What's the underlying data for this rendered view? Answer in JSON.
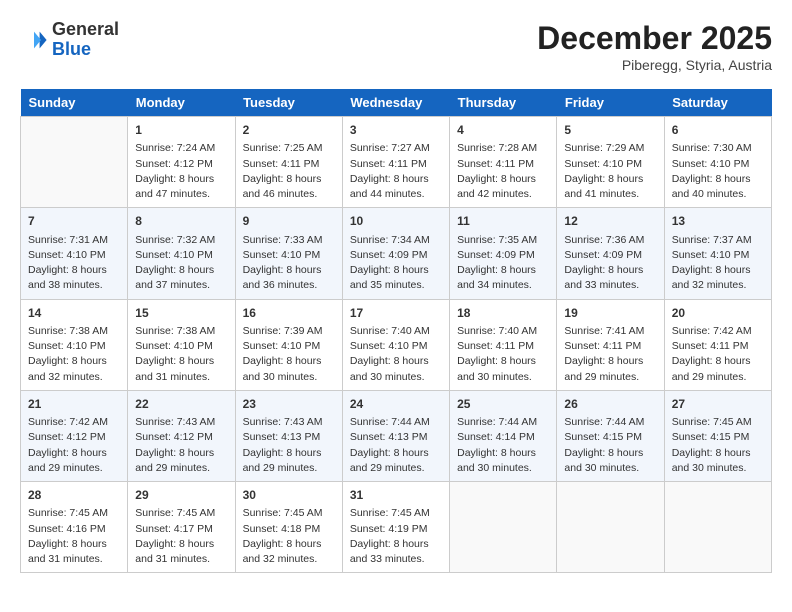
{
  "logo": {
    "general": "General",
    "blue": "Blue"
  },
  "header": {
    "month": "December 2025",
    "location": "Piberegg, Styria, Austria"
  },
  "weekdays": [
    "Sunday",
    "Monday",
    "Tuesday",
    "Wednesday",
    "Thursday",
    "Friday",
    "Saturday"
  ],
  "weeks": [
    [
      {
        "day": "",
        "sunrise": "",
        "sunset": "",
        "daylight": ""
      },
      {
        "day": "1",
        "sunrise": "Sunrise: 7:24 AM",
        "sunset": "Sunset: 4:12 PM",
        "daylight": "Daylight: 8 hours and 47 minutes."
      },
      {
        "day": "2",
        "sunrise": "Sunrise: 7:25 AM",
        "sunset": "Sunset: 4:11 PM",
        "daylight": "Daylight: 8 hours and 46 minutes."
      },
      {
        "day": "3",
        "sunrise": "Sunrise: 7:27 AM",
        "sunset": "Sunset: 4:11 PM",
        "daylight": "Daylight: 8 hours and 44 minutes."
      },
      {
        "day": "4",
        "sunrise": "Sunrise: 7:28 AM",
        "sunset": "Sunset: 4:11 PM",
        "daylight": "Daylight: 8 hours and 42 minutes."
      },
      {
        "day": "5",
        "sunrise": "Sunrise: 7:29 AM",
        "sunset": "Sunset: 4:10 PM",
        "daylight": "Daylight: 8 hours and 41 minutes."
      },
      {
        "day": "6",
        "sunrise": "Sunrise: 7:30 AM",
        "sunset": "Sunset: 4:10 PM",
        "daylight": "Daylight: 8 hours and 40 minutes."
      }
    ],
    [
      {
        "day": "7",
        "sunrise": "Sunrise: 7:31 AM",
        "sunset": "Sunset: 4:10 PM",
        "daylight": "Daylight: 8 hours and 38 minutes."
      },
      {
        "day": "8",
        "sunrise": "Sunrise: 7:32 AM",
        "sunset": "Sunset: 4:10 PM",
        "daylight": "Daylight: 8 hours and 37 minutes."
      },
      {
        "day": "9",
        "sunrise": "Sunrise: 7:33 AM",
        "sunset": "Sunset: 4:10 PM",
        "daylight": "Daylight: 8 hours and 36 minutes."
      },
      {
        "day": "10",
        "sunrise": "Sunrise: 7:34 AM",
        "sunset": "Sunset: 4:09 PM",
        "daylight": "Daylight: 8 hours and 35 minutes."
      },
      {
        "day": "11",
        "sunrise": "Sunrise: 7:35 AM",
        "sunset": "Sunset: 4:09 PM",
        "daylight": "Daylight: 8 hours and 34 minutes."
      },
      {
        "day": "12",
        "sunrise": "Sunrise: 7:36 AM",
        "sunset": "Sunset: 4:09 PM",
        "daylight": "Daylight: 8 hours and 33 minutes."
      },
      {
        "day": "13",
        "sunrise": "Sunrise: 7:37 AM",
        "sunset": "Sunset: 4:10 PM",
        "daylight": "Daylight: 8 hours and 32 minutes."
      }
    ],
    [
      {
        "day": "14",
        "sunrise": "Sunrise: 7:38 AM",
        "sunset": "Sunset: 4:10 PM",
        "daylight": "Daylight: 8 hours and 32 minutes."
      },
      {
        "day": "15",
        "sunrise": "Sunrise: 7:38 AM",
        "sunset": "Sunset: 4:10 PM",
        "daylight": "Daylight: 8 hours and 31 minutes."
      },
      {
        "day": "16",
        "sunrise": "Sunrise: 7:39 AM",
        "sunset": "Sunset: 4:10 PM",
        "daylight": "Daylight: 8 hours and 30 minutes."
      },
      {
        "day": "17",
        "sunrise": "Sunrise: 7:40 AM",
        "sunset": "Sunset: 4:10 PM",
        "daylight": "Daylight: 8 hours and 30 minutes."
      },
      {
        "day": "18",
        "sunrise": "Sunrise: 7:40 AM",
        "sunset": "Sunset: 4:11 PM",
        "daylight": "Daylight: 8 hours and 30 minutes."
      },
      {
        "day": "19",
        "sunrise": "Sunrise: 7:41 AM",
        "sunset": "Sunset: 4:11 PM",
        "daylight": "Daylight: 8 hours and 29 minutes."
      },
      {
        "day": "20",
        "sunrise": "Sunrise: 7:42 AM",
        "sunset": "Sunset: 4:11 PM",
        "daylight": "Daylight: 8 hours and 29 minutes."
      }
    ],
    [
      {
        "day": "21",
        "sunrise": "Sunrise: 7:42 AM",
        "sunset": "Sunset: 4:12 PM",
        "daylight": "Daylight: 8 hours and 29 minutes."
      },
      {
        "day": "22",
        "sunrise": "Sunrise: 7:43 AM",
        "sunset": "Sunset: 4:12 PM",
        "daylight": "Daylight: 8 hours and 29 minutes."
      },
      {
        "day": "23",
        "sunrise": "Sunrise: 7:43 AM",
        "sunset": "Sunset: 4:13 PM",
        "daylight": "Daylight: 8 hours and 29 minutes."
      },
      {
        "day": "24",
        "sunrise": "Sunrise: 7:44 AM",
        "sunset": "Sunset: 4:13 PM",
        "daylight": "Daylight: 8 hours and 29 minutes."
      },
      {
        "day": "25",
        "sunrise": "Sunrise: 7:44 AM",
        "sunset": "Sunset: 4:14 PM",
        "daylight": "Daylight: 8 hours and 30 minutes."
      },
      {
        "day": "26",
        "sunrise": "Sunrise: 7:44 AM",
        "sunset": "Sunset: 4:15 PM",
        "daylight": "Daylight: 8 hours and 30 minutes."
      },
      {
        "day": "27",
        "sunrise": "Sunrise: 7:45 AM",
        "sunset": "Sunset: 4:15 PM",
        "daylight": "Daylight: 8 hours and 30 minutes."
      }
    ],
    [
      {
        "day": "28",
        "sunrise": "Sunrise: 7:45 AM",
        "sunset": "Sunset: 4:16 PM",
        "daylight": "Daylight: 8 hours and 31 minutes."
      },
      {
        "day": "29",
        "sunrise": "Sunrise: 7:45 AM",
        "sunset": "Sunset: 4:17 PM",
        "daylight": "Daylight: 8 hours and 31 minutes."
      },
      {
        "day": "30",
        "sunrise": "Sunrise: 7:45 AM",
        "sunset": "Sunset: 4:18 PM",
        "daylight": "Daylight: 8 hours and 32 minutes."
      },
      {
        "day": "31",
        "sunrise": "Sunrise: 7:45 AM",
        "sunset": "Sunset: 4:19 PM",
        "daylight": "Daylight: 8 hours and 33 minutes."
      },
      {
        "day": "",
        "sunrise": "",
        "sunset": "",
        "daylight": ""
      },
      {
        "day": "",
        "sunrise": "",
        "sunset": "",
        "daylight": ""
      },
      {
        "day": "",
        "sunrise": "",
        "sunset": "",
        "daylight": ""
      }
    ]
  ]
}
